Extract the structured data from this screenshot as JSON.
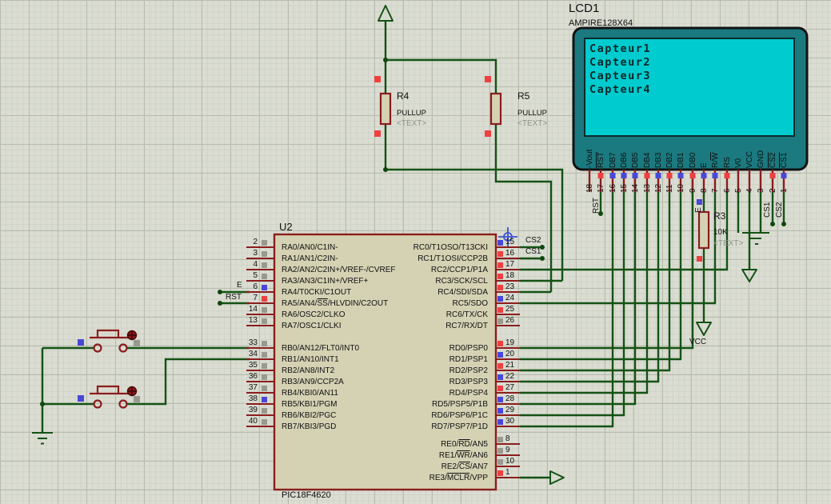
{
  "editor": {
    "cursor": "wire-crosshair"
  },
  "lcd": {
    "ref": "LCD1",
    "part": "AMPIRE128X64",
    "screen_lines": [
      "Capteur1",
      "Capteur2",
      "Capteur3",
      "Capteur4"
    ],
    "pins": [
      {
        "num": "18",
        "name": "-Vout"
      },
      {
        "num": "17",
        "name": "|RST|"
      },
      {
        "num": "16",
        "name": "DB7"
      },
      {
        "num": "15",
        "name": "DB6"
      },
      {
        "num": "14",
        "name": "DB5"
      },
      {
        "num": "13",
        "name": "DB4"
      },
      {
        "num": "12",
        "name": "DB3"
      },
      {
        "num": "11",
        "name": "DB2"
      },
      {
        "num": "10",
        "name": "DB1"
      },
      {
        "num": "9",
        "name": "DB0"
      },
      {
        "num": "8",
        "name": "E"
      },
      {
        "num": "7",
        "name": "R/|W|"
      },
      {
        "num": "6",
        "name": "RS"
      },
      {
        "num": "5",
        "name": "V0"
      },
      {
        "num": "4",
        "name": "VCC"
      },
      {
        "num": "3",
        "name": "GND"
      },
      {
        "num": "2",
        "name": "|CS2|"
      },
      {
        "num": "1",
        "name": "|CS1|"
      }
    ]
  },
  "mcu": {
    "ref": "U2",
    "part": "PIC18F4620",
    "left_pins": [
      {
        "num": "2",
        "label": "RA0/AN0/C1IN-"
      },
      {
        "num": "3",
        "label": "RA1/AN1/C2IN-"
      },
      {
        "num": "4",
        "label": "RA2/AN2/C2IN+/VREF-/CVREF"
      },
      {
        "num": "5",
        "label": "RA3/AN3/C1IN+/VREF+"
      },
      {
        "num": "6",
        "label": "RA4/T0CKI/C1OUT"
      },
      {
        "num": "7",
        "label": "RA5/AN4/|SS|/HLVDIN/C2OUT"
      },
      {
        "num": "14",
        "label": "RA6/OSC2/CLKO"
      },
      {
        "num": "13",
        "label": "RA7/OSC1/CLKI"
      },
      {
        "num": "33",
        "label": "RB0/AN12/FLT0/INT0"
      },
      {
        "num": "34",
        "label": "RB1/AN10/INT1"
      },
      {
        "num": "35",
        "label": "RB2/AN8/INT2"
      },
      {
        "num": "36",
        "label": "RB3/AN9/CCP2A"
      },
      {
        "num": "37",
        "label": "RB4/KBI0/AN11"
      },
      {
        "num": "38",
        "label": "RB5/KBI1/PGM"
      },
      {
        "num": "39",
        "label": "RB6/KBI2/PGC"
      },
      {
        "num": "40",
        "label": "RB7/KBI3/PGD"
      }
    ],
    "right_pins": [
      {
        "num": "15",
        "label": "RC0/T1OSO/T13CKI"
      },
      {
        "num": "16",
        "label": "RC1/T1OSI/CCP2B"
      },
      {
        "num": "17",
        "label": "RC2/CCP1/P1A"
      },
      {
        "num": "18",
        "label": "RC3/SCK/SCL"
      },
      {
        "num": "23",
        "label": "RC4/SDI/SDA"
      },
      {
        "num": "24",
        "label": "RC5/SDO"
      },
      {
        "num": "25",
        "label": "RC6/TX/CK"
      },
      {
        "num": "26",
        "label": "RC7/RX/DT"
      },
      {
        "num": "19",
        "label": "RD0/PSP0"
      },
      {
        "num": "20",
        "label": "RD1/PSP1"
      },
      {
        "num": "21",
        "label": "RD2/PSP2"
      },
      {
        "num": "22",
        "label": "RD3/PSP3"
      },
      {
        "num": "27",
        "label": "RD4/PSP4"
      },
      {
        "num": "28",
        "label": "RD5/PSP5/P1B"
      },
      {
        "num": "29",
        "label": "RD6/PSP6/P1C"
      },
      {
        "num": "30",
        "label": "RD7/PSP7/P1D"
      },
      {
        "num": "8",
        "label": "RE0/|RD|/AN5"
      },
      {
        "num": "9",
        "label": "RE1/|WR|/AN6"
      },
      {
        "num": "10",
        "label": "RE2/|CS|/AN7"
      },
      {
        "num": "1",
        "label": "RE3/|MCLR|/VPP"
      }
    ]
  },
  "resistors": [
    {
      "ref": "R4",
      "value": "PULLUP",
      "text": "<TEXT>"
    },
    {
      "ref": "R5",
      "value": "PULLUP",
      "text": "<TEXT>"
    },
    {
      "ref": "R3",
      "value": "10K",
      "text": "<TEXT>"
    }
  ],
  "net_labels": {
    "mcu_e": "E",
    "mcu_rst": "RST",
    "mcu_cs2": "CS2",
    "mcu_cs1": "CS1",
    "lcd_rst": "RST",
    "lcd_e": "E",
    "lcd_cs1": "CS1",
    "lcd_cs2": "CS2",
    "vcc": "VCC"
  },
  "colors": {
    "wire": "#145214",
    "outline": "#8b1d1d",
    "chip_fill": "#d5d2b4",
    "lcd_body": "#1a7a80",
    "lcd_screen": "#00ccd0",
    "marker_red": "#ee4040",
    "marker_blue": "#4848d8",
    "marker_gray": "#99998f"
  }
}
